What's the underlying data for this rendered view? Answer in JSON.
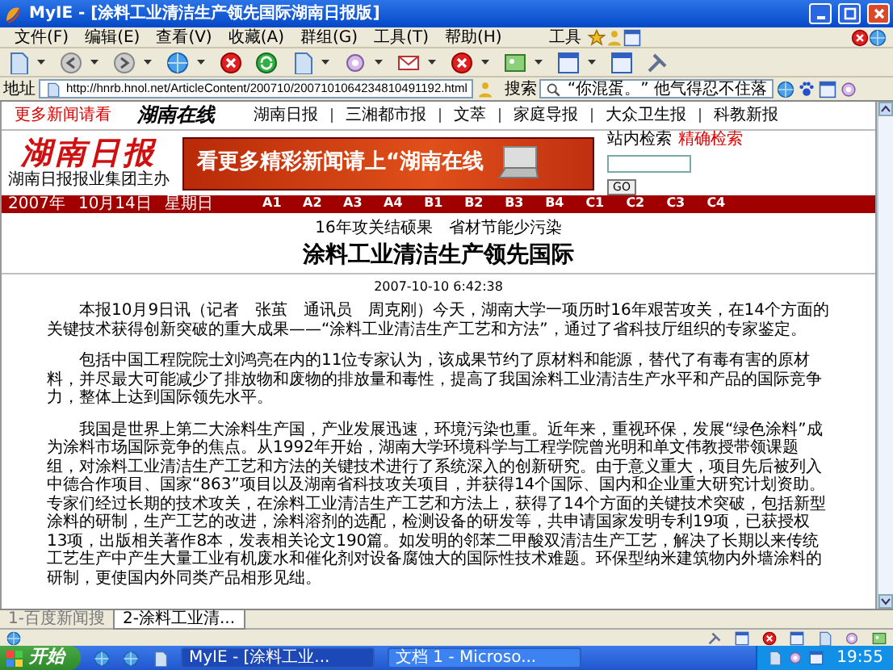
{
  "window": {
    "title": "MyIE - [涂料工业清洁生产领先国际湖南日报版]"
  },
  "menu": [
    "文件(F)",
    "编辑(E)",
    "查看(V)",
    "收藏(A)",
    "群组(G)",
    "工具(T)",
    "帮助(H)"
  ],
  "toolbar_label": "工具",
  "address_bar": {
    "label": "地址",
    "url": "http://hnrb.hnol.net/ArticleContent/200710/2007101064234810491192.html"
  },
  "search_bar": {
    "label": "搜索",
    "value": "“你混蛋。” 他气得忍不住落"
  },
  "site": {
    "top_nav": {
      "more_link": "更多新闻请看",
      "logo_text": "湖南在线",
      "papers": [
        "湖南日报",
        "三湘都市报",
        "文萃",
        "家庭导报",
        "大众卫生报",
        "科教新报"
      ]
    },
    "masthead": {
      "logo": "湖南日报",
      "subtitle": "湖南日报报业集团主办",
      "banner": "看更多精彩新闻请上“湖南在线",
      "search_label": "站内检索",
      "precise_search": "精确检索",
      "go": "GO"
    },
    "date_bar": {
      "year": "2007年",
      "date": "10月14日",
      "weekday": "星期日",
      "sections": [
        "A1",
        "A2",
        "A3",
        "A4",
        "B1",
        "B2",
        "B3",
        "B4",
        "C1",
        "C2",
        "C3",
        "C4"
      ]
    },
    "article": {
      "kicker": "16年攻关结硕果　省材节能少污染",
      "title": "涂料工业清洁生产领先国际",
      "timestamp": "2007-10-10 6:42:38",
      "paragraphs": [
        "本报10月9日讯（记者　张茧　通讯员　周克刚）今天，湖南大学一项历时16年艰苦攻关，在14个方面的关键技术获得创新突破的重大成果——“涂料工业清洁生产工艺和方法”，通过了省科技厅组织的专家鉴定。",
        "包括中国工程院院士刘鸿亮在内的11位专家认为，该成果节约了原材料和能源，替代了有毒有害的原材料，并尽最大可能减少了排放物和废物的排放量和毒性，提高了我国涂料工业清洁生产水平和产品的国际竞争力，整体上达到国际领先水平。",
        "我国是世界上第二大涂料生产国，产业发展迅速，环境污染也重。近年来，重视环保，发展“绿色涂料”成为涂料市场国际竞争的焦点。从1992年开始，湖南大学环境科学与工程学院曾光明和单文伟教授带领课题组，对涂料工业清洁生产工艺和方法的关键技术进行了系统深入的创新研究。由于意义重大，项目先后被列入中德合作项目、国家“863”项目以及湖南省科技攻关项目，并获得14个国际、国内和企业重大研究计划资助。专家们经过长期的技术攻关，在涂料工业清洁生产工艺和方法上，获得了14个方面的关键技术突破，包括新型涂料的研制，生产工艺的改进，涂料溶剂的选配，检测设备的研发等，共申请国家发明专利19项，已获授权13项，出版相关著作8本，发表相关论文190篇。如发明的邻苯二甲酸双清洁生产工艺，解决了长期以来传统工艺生产中产生大量工业有机废水和催化剂对设备腐蚀大的国际性技术难题。环保型纳米建筑物内外墙涂料的研制，更使国内外同类产品相形见绌。"
      ]
    }
  },
  "page_tabs": [
    {
      "label": "1-百度新闻搜",
      "selected": false
    },
    {
      "label": "2-涂料工业清...",
      "selected": true
    }
  ],
  "taskbar": {
    "start": "开始",
    "tasks": [
      {
        "label": "MyIE - [涂料工业...",
        "selected": true
      },
      {
        "label": "文档 1 - Microso...",
        "selected": false
      }
    ],
    "clock": "19:55"
  }
}
